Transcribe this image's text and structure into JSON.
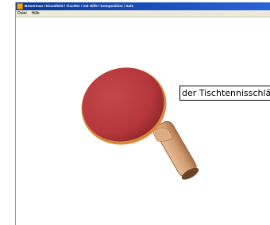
{
  "window": {
    "title": "Bewerman / Einzelbild / Tischler / mit Hilfe / Komposition / Satz"
  },
  "menu": {
    "items": [
      "Datei",
      "Hilfe"
    ]
  },
  "image": {
    "icon": "table-tennis-bat-image",
    "colors": {
      "rubber": "#b5373b",
      "rubber_dark": "#7e1f22",
      "handle": "#d9a57a",
      "handle_dark": "#a86f45"
    }
  },
  "caption": {
    "text": "der Tischtennisschläger"
  }
}
